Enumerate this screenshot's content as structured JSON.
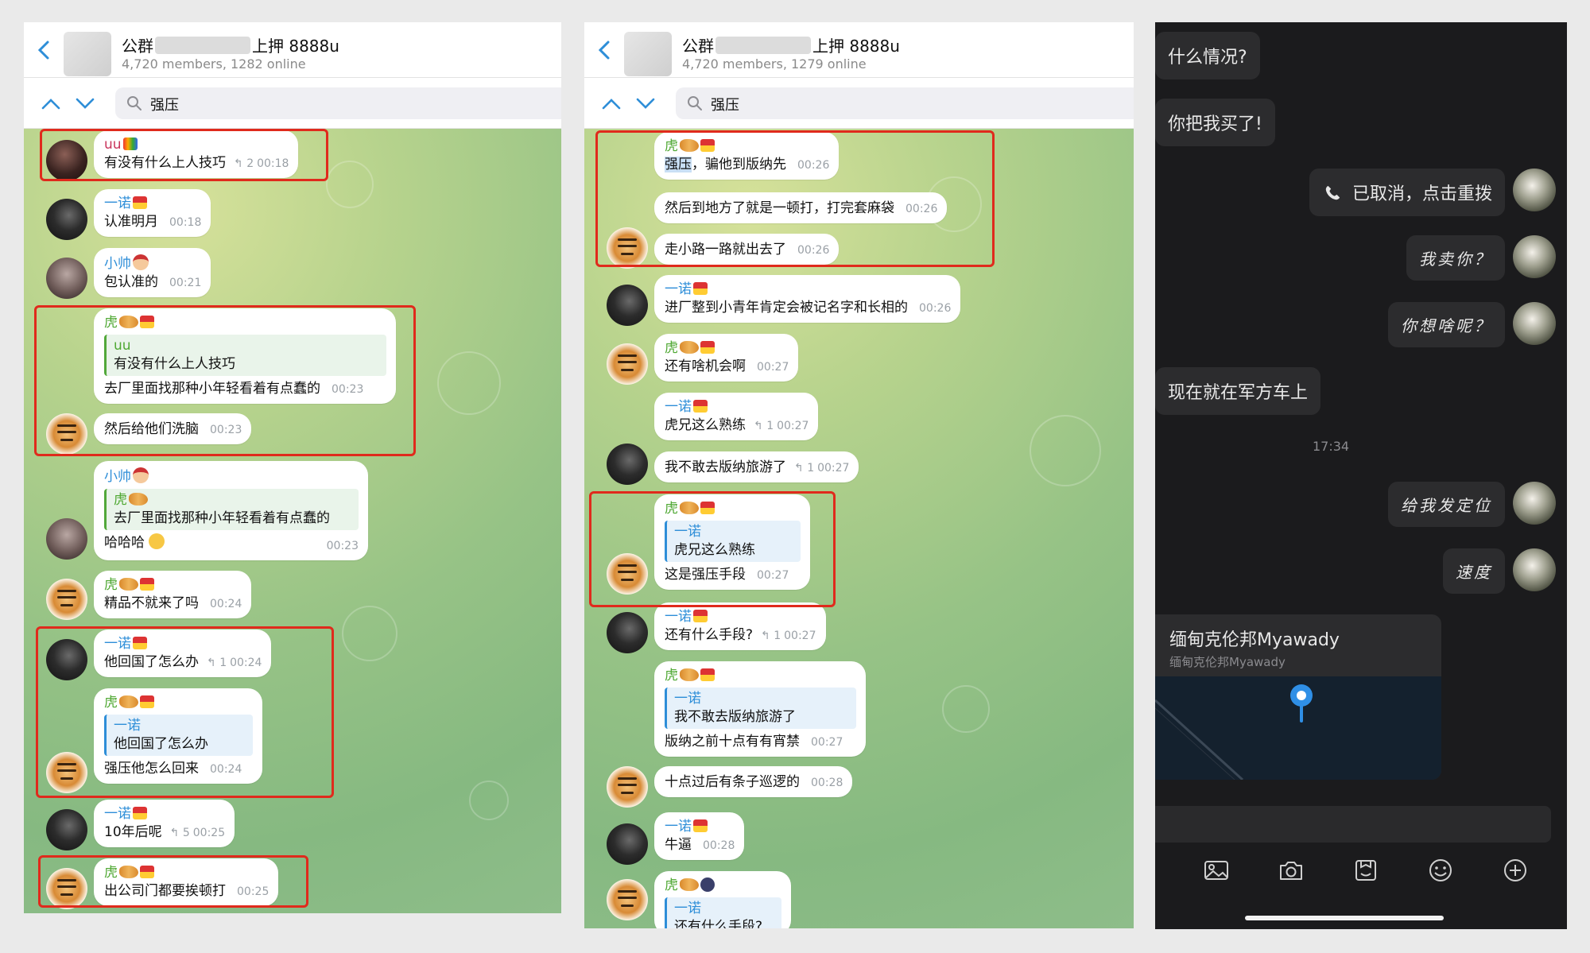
{
  "colors": {
    "accent_blue": "#2e8ed8",
    "highlight_red": "#e02a1c",
    "chat_green": "#9cc886",
    "dark_bg": "#1b1b1d"
  },
  "left_panel": {
    "header": {
      "title_prefix": "公群",
      "title_suffix": "上押 8888u",
      "subtitle": "4,720 members, 1282 online"
    },
    "search": {
      "query": "强压"
    },
    "messages": [
      {
        "name": "uu",
        "text": "有没有什么上人技巧",
        "replies": "2",
        "time": "00:18"
      },
      {
        "name": "一诺",
        "text": "认准明月",
        "time": "00:18"
      },
      {
        "name": "小帅",
        "text": "包认准的",
        "time": "00:21"
      },
      {
        "name": "虎",
        "quote_name": "uu",
        "quote_text": "有没有什么上人技巧",
        "text": "去厂里面找那种小年轻看着有点蠢的",
        "time": "00:23"
      },
      {
        "text": "然后给他们洗脑",
        "time": "00:23"
      },
      {
        "name": "小帅",
        "quote_name": "虎",
        "quote_text": "去厂里面找那种小年轻看着有点蠢的",
        "text": "哈哈哈",
        "time": "00:23"
      },
      {
        "name": "虎",
        "text": "精品不就来了吗",
        "time": "00:24"
      },
      {
        "name": "一诺",
        "text": "他回国了怎么办",
        "replies": "1",
        "time": "00:24"
      },
      {
        "name": "虎",
        "quote_name": "一诺",
        "quote_text": "他回国了怎么办",
        "text": "强压他怎么回来",
        "time": "00:24"
      },
      {
        "name": "一诺",
        "text": "10年后呢",
        "replies": "5",
        "time": "00:25"
      },
      {
        "name": "虎",
        "text": "出公司门都要挨顿打",
        "time": "00:25"
      }
    ]
  },
  "middle_panel": {
    "header": {
      "title_prefix": "公群",
      "title_suffix": "上押 8888u",
      "subtitle": "4,720 members, 1279 online"
    },
    "search": {
      "query": "强压"
    },
    "messages": [
      {
        "name": "虎",
        "text_highlight": "强压",
        "text": "，骗他到版纳先",
        "time": "00:26"
      },
      {
        "text": "然后到地方了就是一顿打，打完套麻袋",
        "time": "00:26"
      },
      {
        "text": "走小路一路就出去了",
        "time": "00:26"
      },
      {
        "name": "一诺",
        "text": "进厂整到小青年肯定会被记名字和长相的",
        "time": "00:26"
      },
      {
        "name": "虎",
        "text": "还有啥机会啊",
        "time": "00:27"
      },
      {
        "name": "一诺",
        "text": "虎兄这么熟练",
        "replies": "1",
        "time": "00:27"
      },
      {
        "text": "我不敢去版纳旅游了",
        "replies": "1",
        "time": "00:27"
      },
      {
        "name": "虎",
        "quote_name": "一诺",
        "quote_text": "虎兄这么熟练",
        "text": "这是强压手段",
        "time": "00:27"
      },
      {
        "name": "一诺",
        "text": "还有什么手段?",
        "replies": "1",
        "time": "00:27"
      },
      {
        "name": "虎",
        "quote_name": "一诺",
        "quote_text": "我不敢去版纳旅游了",
        "text": "版纳之前十点有有宵禁",
        "time": "00:27"
      },
      {
        "text": "十点过后有条子巡逻的",
        "time": "00:28"
      },
      {
        "name": "一诺",
        "text": "牛逼",
        "time": "00:28"
      },
      {
        "name": "虎",
        "quote_name": "一诺",
        "quote_text": "还有什么手段?"
      }
    ]
  },
  "right_panel": {
    "messages": [
      {
        "text": "什么情况?"
      },
      {
        "text": "你把我买了!"
      },
      {
        "text": "已取消，点击重拨"
      },
      {
        "text": "我卖你？"
      },
      {
        "text": "你想啥呢？"
      },
      {
        "text": "现在就在军方车上"
      },
      {
        "text": "给我发定位"
      },
      {
        "text": "速度"
      }
    ],
    "timestamp": "17:34",
    "location": {
      "title": "缅甸克伦邦Myawady",
      "subtitle": "缅甸克伦邦Myawady"
    },
    "toolbar": [
      "image-icon",
      "camera-icon",
      "sticker-icon",
      "emoji-icon",
      "plus-icon"
    ]
  }
}
